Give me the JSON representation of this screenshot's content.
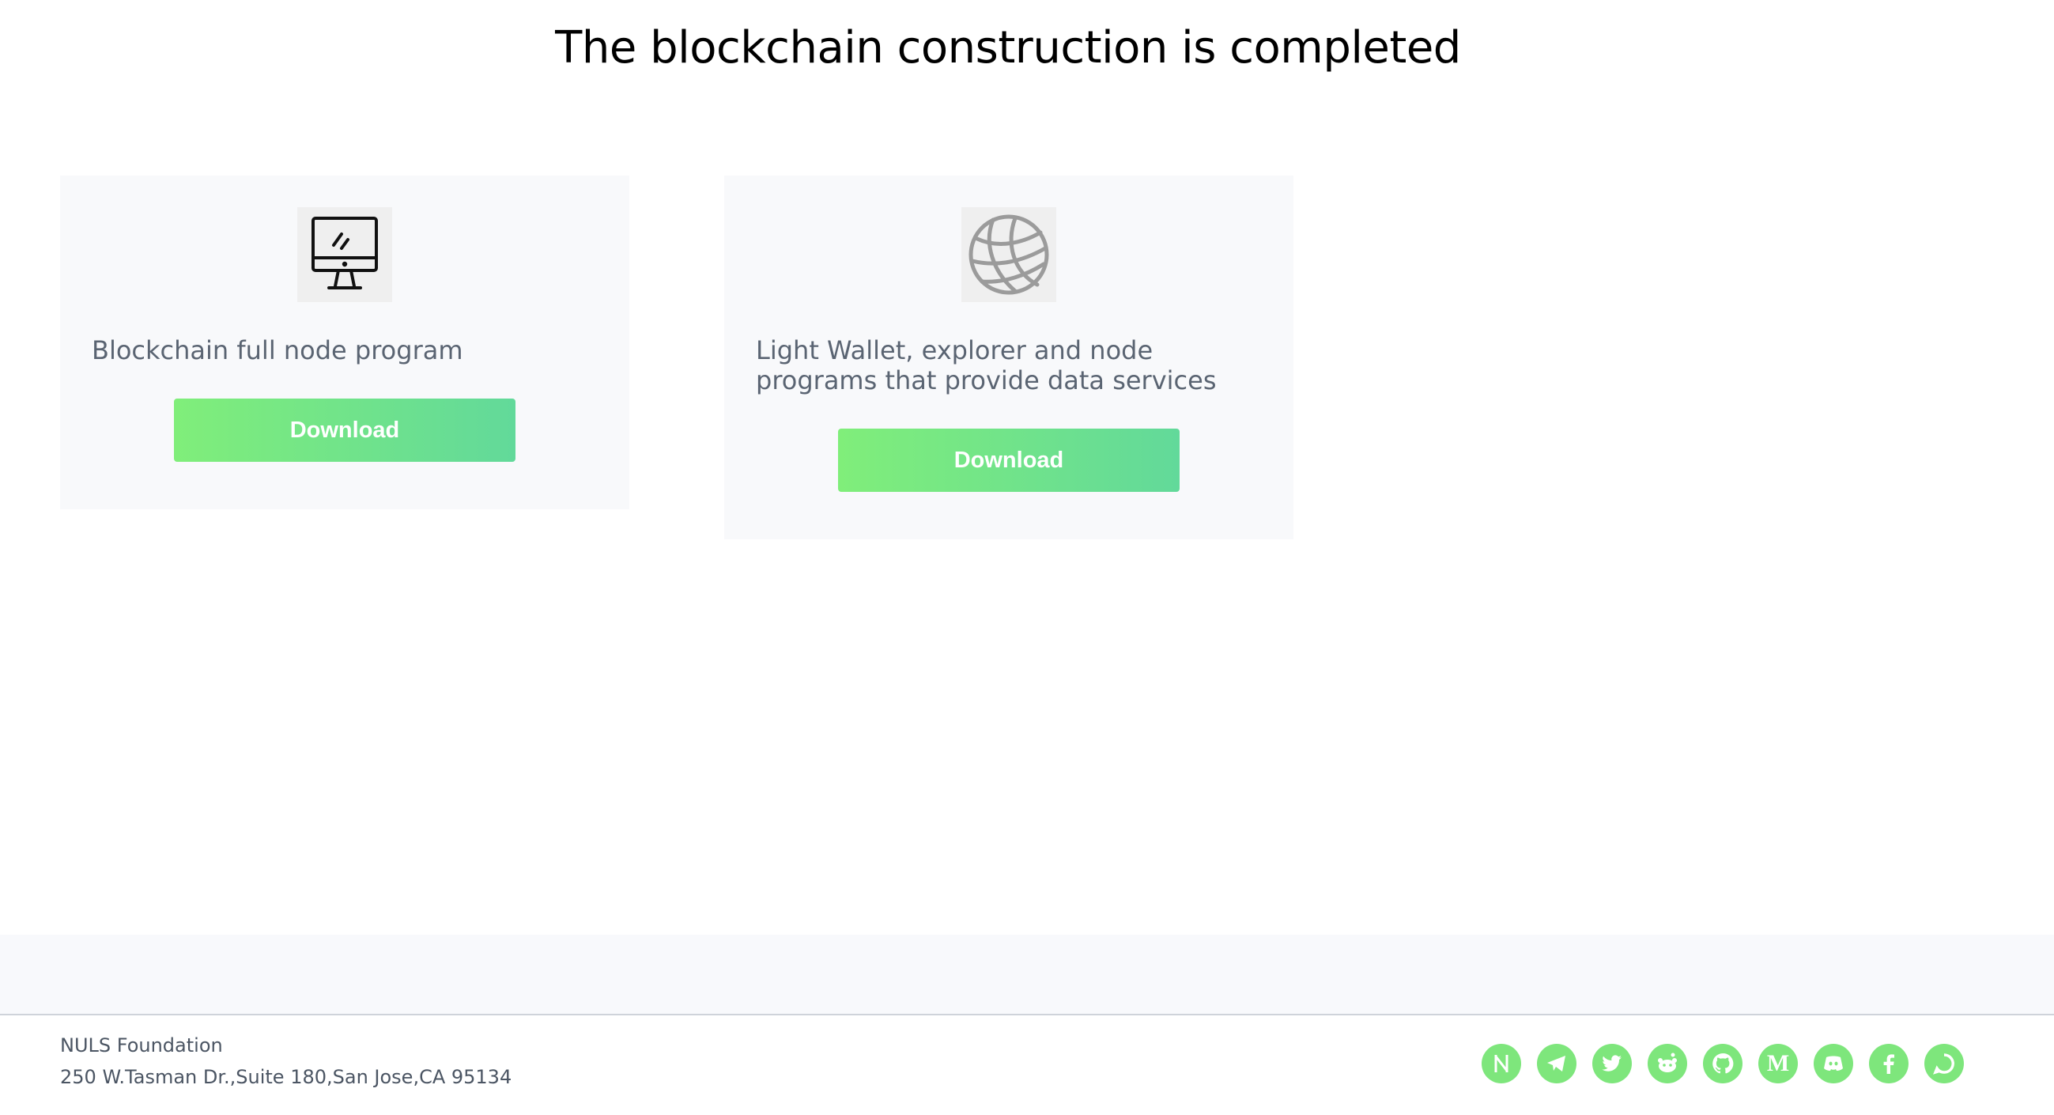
{
  "page": {
    "title": "The blockchain construction is completed"
  },
  "cards": [
    {
      "icon": "desktop-monitor-icon",
      "text": "Blockchain full node program",
      "button_label": "Download"
    },
    {
      "icon": "globe-icon",
      "text": "Light Wallet, explorer and node programs that provide data services",
      "button_label": "Download"
    }
  ],
  "footer": {
    "org_name": "NULS Foundation",
    "address": "250 W.Tasman Dr.,Suite 180,San Jose,CA 95134",
    "socials": [
      {
        "icon": "nuls-icon",
        "glyph": "N"
      },
      {
        "icon": "telegram-icon"
      },
      {
        "icon": "twitter-icon"
      },
      {
        "icon": "reddit-icon"
      },
      {
        "icon": "github-icon"
      },
      {
        "icon": "medium-icon",
        "glyph": "M"
      },
      {
        "icon": "discord-icon"
      },
      {
        "icon": "facebook-icon",
        "glyph": "f"
      },
      {
        "icon": "chat-icon"
      }
    ]
  },
  "colors": {
    "accent_start": "#80ee7a",
    "accent_end": "#62d99a",
    "social_green": "#7ee67c",
    "card_bg": "#f8f9fb",
    "muted_text": "#5a6472"
  }
}
